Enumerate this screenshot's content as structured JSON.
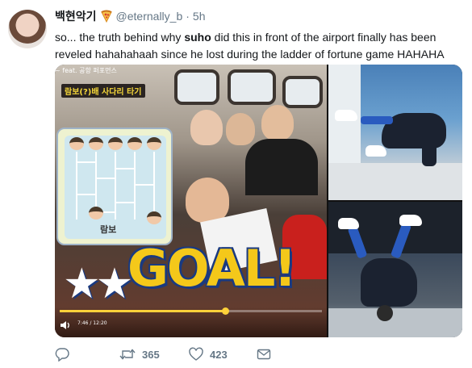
{
  "tweet": {
    "display_name": "백현악기",
    "handle": "@eternally_b",
    "separator": "·",
    "time": "5h",
    "text_before": "so... the truth behind why ",
    "text_bold": "suho",
    "text_after": " did this in front of the airport finally has been reveled hahahahaah since he lost during the ladder of fortune game HAHAHA"
  },
  "media": {
    "caption_bar": "~ feat. 공항 퍼포먼스",
    "caption_tag": "람보(?)배 사다리 타기",
    "ladder_label": "람보",
    "goal_text": "GOAL!",
    "stars": "★★",
    "video_time": "7:46 / 12:20",
    "progress": 0.63
  },
  "actions": {
    "retweet_count": "365",
    "like_count": "423"
  },
  "icons": [
    "pizza-icon",
    "reply-icon",
    "retweet-icon",
    "heart-icon",
    "mail-icon",
    "volume-icon"
  ],
  "colors": {
    "text": "#14171a",
    "muted": "#657786",
    "goal_yellow": "#f4c81a",
    "goal_outline": "#1a3a80"
  }
}
